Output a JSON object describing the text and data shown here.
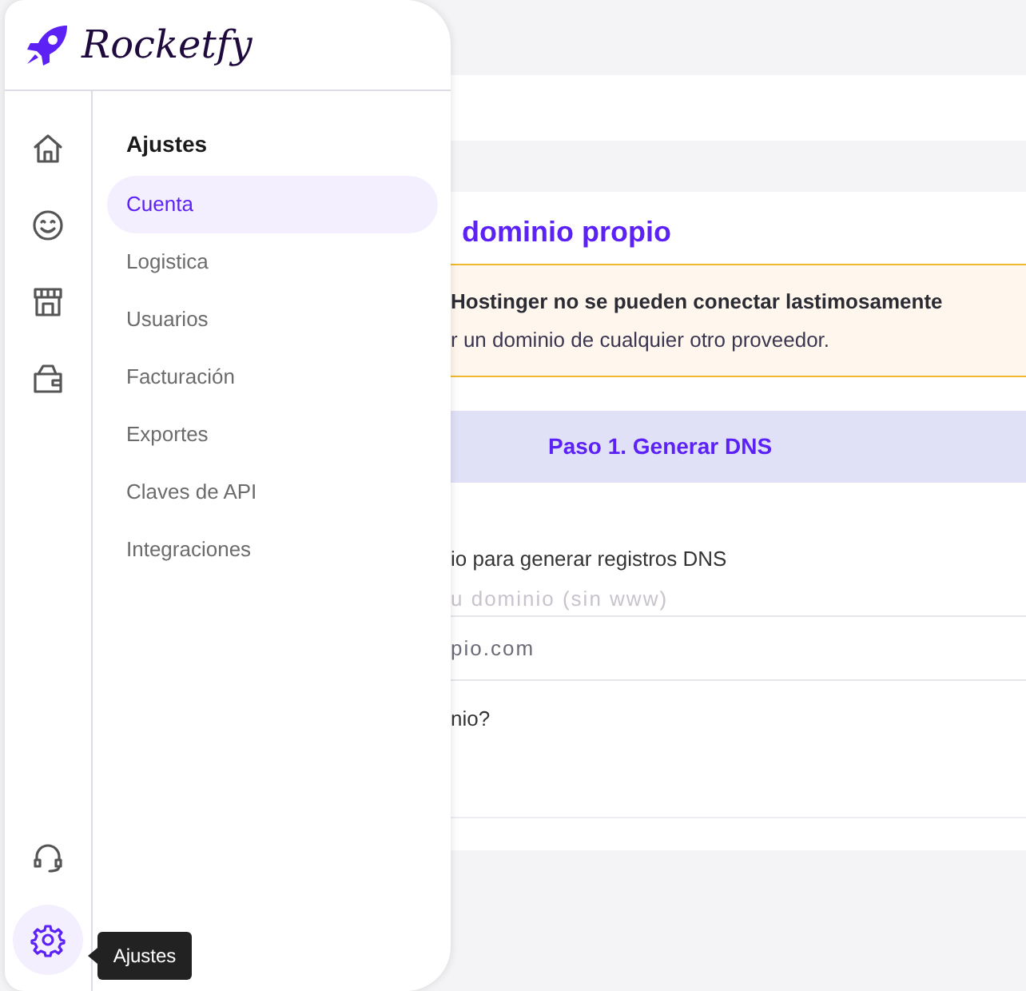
{
  "brand": {
    "name": "Rocketfy"
  },
  "rail": [
    {
      "kind": "home",
      "selected": false
    },
    {
      "kind": "smile",
      "selected": false
    },
    {
      "kind": "store",
      "selected": false
    },
    {
      "kind": "wallet",
      "selected": false
    },
    {
      "kind": "support",
      "selected": false
    },
    {
      "kind": "settings",
      "selected": true
    }
  ],
  "submenu": {
    "title": "Ajustes",
    "items": [
      {
        "label": "Cuenta",
        "selected": true
      },
      {
        "label": "Logistica",
        "selected": false
      },
      {
        "label": "Usuarios",
        "selected": false
      },
      {
        "label": "Facturación",
        "selected": false
      },
      {
        "label": "Exportes",
        "selected": false
      },
      {
        "label": "Claves de API",
        "selected": false
      },
      {
        "label": "Integraciones",
        "selected": false
      }
    ]
  },
  "tooltip": "Ajustes",
  "main": {
    "heading": "dominio propio",
    "warning": {
      "title": "Hostinger no se pueden conectar lastimosamente",
      "text": "r un dominio de cualquier otro proveedor."
    },
    "step": "Paso 1. Generar DNS",
    "field_label": "io para generar registros DNS",
    "field": {
      "placeholder": "u dominio (sin www)",
      "value": "pio.com"
    },
    "question": "nio?"
  }
}
